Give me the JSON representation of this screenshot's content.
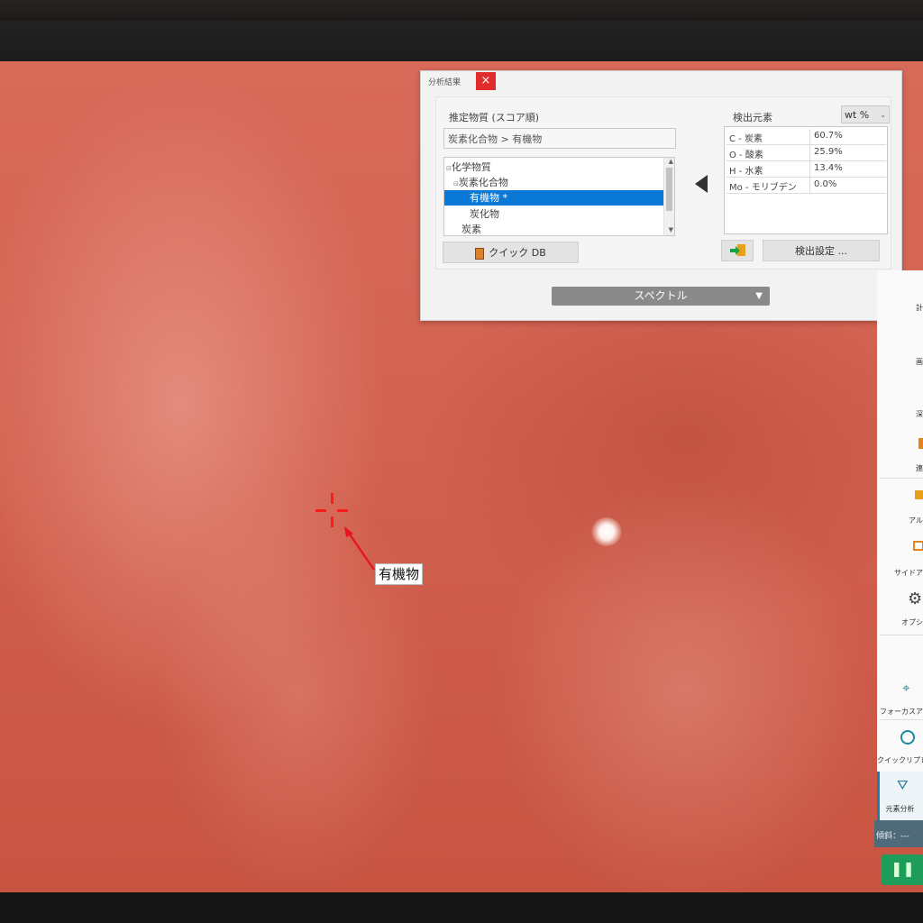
{
  "dialog": {
    "title": "分析結果",
    "close": "×",
    "estimated_label": "推定物質 (スコア順)",
    "estimated_value": "炭素化合物 > 有機物",
    "tree": [
      {
        "label": "化学物質",
        "prefix": "⊟"
      },
      {
        "label": "炭素化合物",
        "prefix": "⊟"
      },
      {
        "label": "有機物 *",
        "prefix": "",
        "selected": true
      },
      {
        "label": "炭化物",
        "prefix": ""
      },
      {
        "label": "炭素",
        "prefix": ""
      }
    ],
    "quick_db": "クイック DB",
    "detected_label": "検出元素",
    "unit": "wt %",
    "elements": [
      {
        "name": "C - 炭素",
        "value": "60.7%"
      },
      {
        "name": "O - 酸素",
        "value": "25.9%"
      },
      {
        "name": "H - 水素",
        "value": "13.4%"
      },
      {
        "name": "Mo - モリブデン",
        "value": "0.0%"
      }
    ],
    "detect_settings": "検出設定 ...",
    "spectrum": "スペクトル"
  },
  "marker": {
    "label": "有機物"
  },
  "side_panel": {
    "items": [
      "計",
      "画",
      "深",
      "連",
      "アル",
      "サイドア",
      "オプシ",
      "フォーカスア",
      "クイックリプレ",
      "元素分析"
    ],
    "tilt": "傾斜：---"
  },
  "colors": {
    "selection": "#0a78d7",
    "crosshair": "#ff1a1a",
    "close": "#e02c2c",
    "run": "#1e9c5a"
  }
}
